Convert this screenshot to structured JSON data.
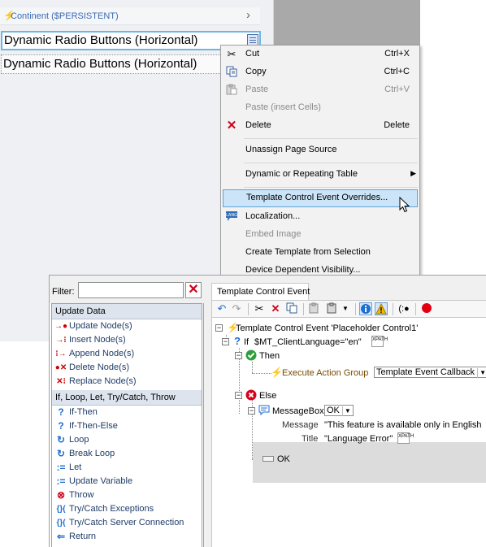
{
  "design": {
    "continent_label": "Continent ($PERSISTENT)",
    "dynamic_rows": [
      "Dynamic Radio Buttons (Horizontal)",
      "Dynamic Radio Buttons (Horizontal)"
    ]
  },
  "context_menu": {
    "items": [
      {
        "label": "Cut",
        "shortcut": "Ctrl+X",
        "icon": "scissors-icon",
        "enabled": true
      },
      {
        "label": "Copy",
        "shortcut": "Ctrl+C",
        "icon": "copy-icon",
        "enabled": true
      },
      {
        "label": "Paste",
        "shortcut": "Ctrl+V",
        "icon": "paste-icon",
        "enabled": false
      },
      {
        "label": "Paste (insert Cells)",
        "shortcut": "",
        "icon": "",
        "enabled": false
      },
      {
        "label": "Delete",
        "shortcut": "Delete",
        "icon": "delete-icon",
        "enabled": true
      },
      {
        "label": "Unassign Page Source",
        "shortcut": "",
        "icon": "",
        "enabled": true
      },
      {
        "label": "Dynamic or Repeating Table",
        "shortcut": "",
        "icon": "",
        "enabled": true,
        "submenu": true
      },
      {
        "label": "Template Control Event Overrides...",
        "shortcut": "",
        "icon": "",
        "enabled": true,
        "highlighted": true
      },
      {
        "label": "Localization...",
        "shortcut": "",
        "icon": "localization-icon",
        "enabled": true
      },
      {
        "label": "Embed Image",
        "shortcut": "",
        "icon": "",
        "enabled": false
      },
      {
        "label": "Create Template from Selection",
        "shortcut": "",
        "icon": "",
        "enabled": true
      },
      {
        "label": "Device Dependent Visibility...",
        "shortcut": "",
        "icon": "",
        "enabled": true
      }
    ],
    "localization_icon_text": "LANG"
  },
  "actions_panel": {
    "filter_label": "Filter:",
    "filter_value": "",
    "groups": [
      {
        "title": "Update Data",
        "items": [
          "Update Node(s)",
          "Insert Node(s)",
          "Append Node(s)",
          "Delete Node(s)",
          "Replace Node(s)"
        ]
      },
      {
        "title": "If, Loop, Let, Try/Catch, Throw",
        "items": [
          "If-Then",
          "If-Then-Else",
          "Loop",
          "Break Loop",
          "Let",
          "Update Variable",
          "Throw",
          "Try/Catch Exceptions",
          "Try/Catch Server Connection",
          "Return"
        ]
      }
    ]
  },
  "event_panel": {
    "tab_label": "Template Control Event",
    "tree": {
      "root": "Template Control Event 'Placeholder Control1'",
      "if_label": "If",
      "if_condition": "$MT_ClientLanguage=\"en\"",
      "then_label": "Then",
      "execute_label": "Execute Action Group",
      "execute_value": "Template Event Callback",
      "else_label": "Else",
      "messagebox_label": "MessageBox",
      "messagebox_type": "OK",
      "message_label": "Message",
      "message_value": "\"This feature is available only in English",
      "title_label": "Title",
      "title_value": "\"Language Error\"",
      "ok_label": "OK",
      "xpath_text": "XPATH"
    }
  },
  "colors": {
    "highlight": "#cce4f7",
    "highlight_border": "#5fa2d8",
    "group_header": "#dde4ee",
    "link_text": "#1f3c67",
    "delete_red": "#d0021b",
    "continent_blue": "#3b6bb5"
  }
}
